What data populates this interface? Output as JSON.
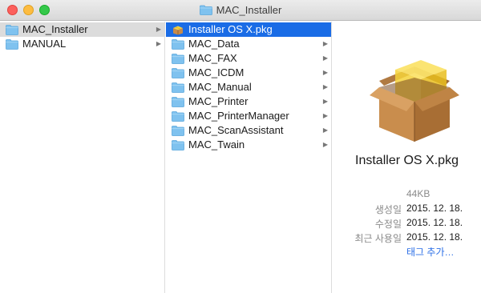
{
  "window": {
    "title": "MAC_Installer"
  },
  "column1": {
    "items": [
      {
        "label": "MAC_Installer",
        "selected": "grey"
      },
      {
        "label": "MANUAL",
        "selected": "none"
      }
    ]
  },
  "column2": {
    "items": [
      {
        "label": "Installer OS X.pkg",
        "selected": "blue",
        "icon": "package-icon"
      },
      {
        "label": "MAC_Data",
        "icon": "folder-icon"
      },
      {
        "label": "MAC_FAX",
        "icon": "folder-icon"
      },
      {
        "label": "MAC_ICDM",
        "icon": "folder-icon"
      },
      {
        "label": "MAC_Manual",
        "icon": "folder-icon"
      },
      {
        "label": "MAC_Printer",
        "icon": "folder-icon"
      },
      {
        "label": "MAC_PrinterManager",
        "icon": "folder-icon"
      },
      {
        "label": "MAC_ScanAssistant",
        "icon": "folder-icon"
      },
      {
        "label": "MAC_Twain",
        "icon": "folder-icon"
      }
    ]
  },
  "preview": {
    "name": "Installer OS X.pkg",
    "size": "44KB",
    "created_label": "생성일",
    "created_value": "2015. 12. 18.",
    "modified_label": "수정일",
    "modified_value": "2015. 12. 18.",
    "last_opened_label": "최근 사용일",
    "last_opened_value": "2015. 12. 18.",
    "add_tags": "태그 추가…"
  },
  "colors": {
    "selection_blue": "#1a6ce6",
    "selection_grey": "#dcdcdc",
    "folder": "#7fc2ef",
    "link": "#2a6ee6"
  }
}
